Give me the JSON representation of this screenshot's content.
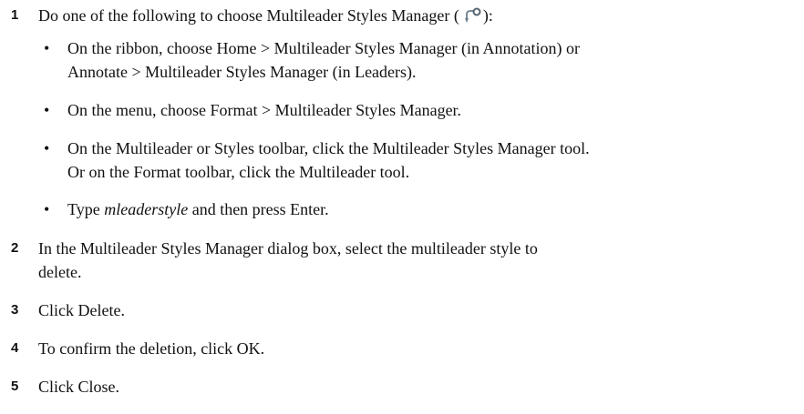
{
  "steps": [
    {
      "number": "1",
      "text_before_icon": "Do one of the following to choose Multileader Styles Manager (",
      "icon": "multileader-styles-manager-icon",
      "text_after_icon": "):",
      "bullets": [
        {
          "lines": [
            "On the ribbon, choose Home > Multileader Styles Manager (in Annotation) or",
            "Annotate > Multileader Styles Manager (in Leaders)."
          ]
        },
        {
          "lines": [
            "On the menu, choose Format > Multileader Styles Manager."
          ]
        },
        {
          "lines": [
            "On the Multileader or Styles toolbar, click the Multileader Styles Manager tool.",
            "Or on the Format toolbar, click the Multileader tool."
          ]
        },
        {
          "prefix": "Type ",
          "emphasis": "mleaderstyle",
          "suffix": " and then press Enter."
        }
      ]
    },
    {
      "number": "2",
      "lines": [
        "In the Multileader Styles Manager dialog box, select the multileader style to",
        "delete."
      ]
    },
    {
      "number": "3",
      "lines": [
        "Click Delete."
      ]
    },
    {
      "number": "4",
      "lines": [
        "To confirm the deletion, click OK."
      ]
    },
    {
      "number": "5",
      "lines": [
        "Click Close."
      ]
    }
  ],
  "bullet_glyph": "•"
}
